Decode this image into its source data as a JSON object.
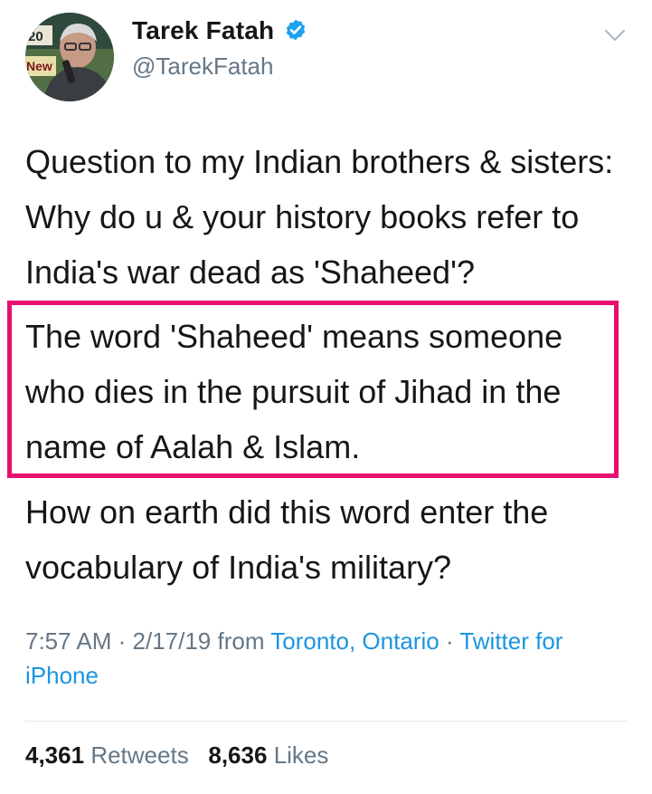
{
  "author": {
    "name": "Tarek Fatah",
    "handle": "@TarekFatah",
    "verified": true,
    "avatar_text_top": "20",
    "avatar_text_left": "New"
  },
  "tweet": {
    "paragraph_1": "Question to my Indian brothers & sisters: Why do u & your history books refer to India's war dead as 'Shaheed'?",
    "paragraph_2": "The word 'Shaheed' means someone who dies in the pursuit of Jihad in the name of Aalah & Islam.",
    "paragraph_3": "How on earth did this word enter the vocabulary of India's military?"
  },
  "meta": {
    "time": "7:57 AM",
    "separator_1": " · ",
    "date": "2/17/19",
    "from_label": " from ",
    "location": "Toronto, Ontario",
    "separator_2": " · ",
    "source": "Twitter for iPhone"
  },
  "stats": {
    "retweets_count": "4,361",
    "retweets_label": "Retweets",
    "likes_count": "8,636",
    "likes_label": "Likes"
  },
  "colors": {
    "highlight_border": "#e8106f",
    "link": "#1b95e0",
    "verified": "#1da1f2",
    "secondary_text": "#657786"
  },
  "icons": [
    "verified-badge-icon",
    "chevron-down-icon"
  ]
}
